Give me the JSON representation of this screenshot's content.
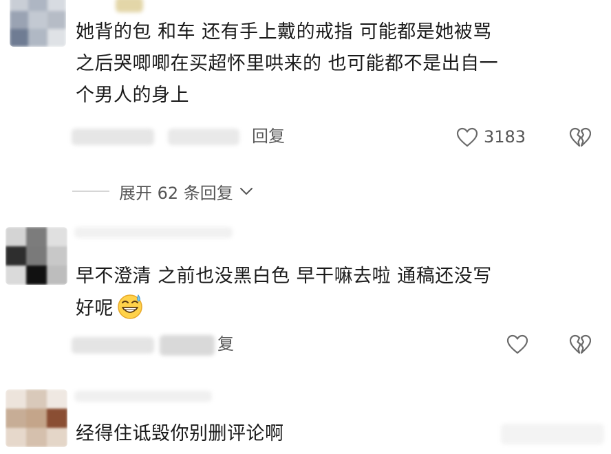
{
  "comments": [
    {
      "text_lines": [
        "她背的包 和车 还有手上戴的戒指 可能都是她被骂",
        "之后哭唧唧在买超怀里哄来的 也可能都不是出自一",
        "个男人的身上"
      ],
      "reply_label": "回复",
      "like_count": "3183"
    },
    {
      "text_lines": [
        "早不澄清 之前也没黑白色 早干嘛去啦 通稿还没写",
        "好呢"
      ],
      "emoji": "grinning-sweat-emoji",
      "reply_label": "复",
      "like_count": ""
    },
    {
      "text_lines": [
        "经得住诋毁你别删评论啊"
      ]
    }
  ],
  "expand_replies": {
    "label": "展开 62 条回复"
  },
  "colors": {
    "text": "#1a1a1a",
    "secondary": "#555555",
    "divider": "#d6d6d6"
  }
}
